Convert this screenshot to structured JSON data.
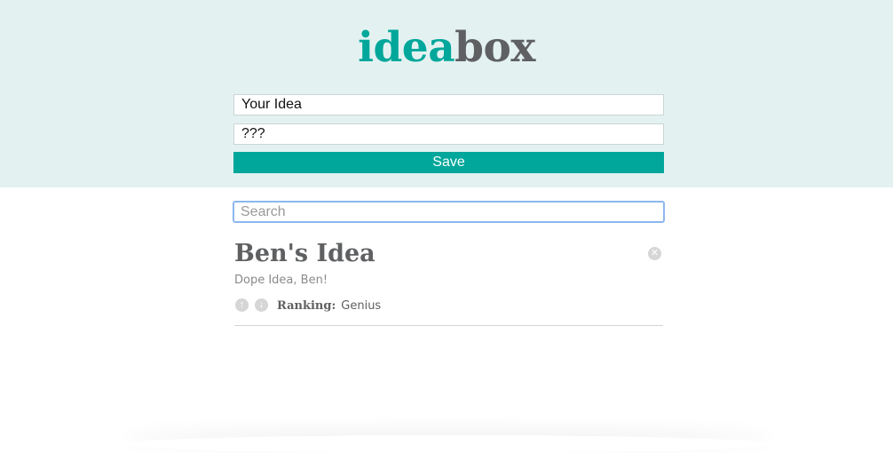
{
  "logo": {
    "part1": "idea",
    "part2": "box"
  },
  "form": {
    "title_value": "Your Idea",
    "body_value": "???",
    "save_label": "Save"
  },
  "search": {
    "placeholder": "Search",
    "value": ""
  },
  "ideas": [
    {
      "title": "Ben's Idea",
      "body": "Dope Idea, Ben!",
      "ranking_label": "Ranking:",
      "ranking_value": "Genius",
      "upvote_icon": "arrow-up-circle-icon",
      "downvote_icon": "arrow-down-circle-icon",
      "delete_icon": "close-circle-icon"
    }
  ],
  "colors": {
    "brand_teal": "#00a79a",
    "brand_gray": "#5f6062",
    "header_bg": "#e3f2f1",
    "search_focus": "#8db7f0"
  }
}
